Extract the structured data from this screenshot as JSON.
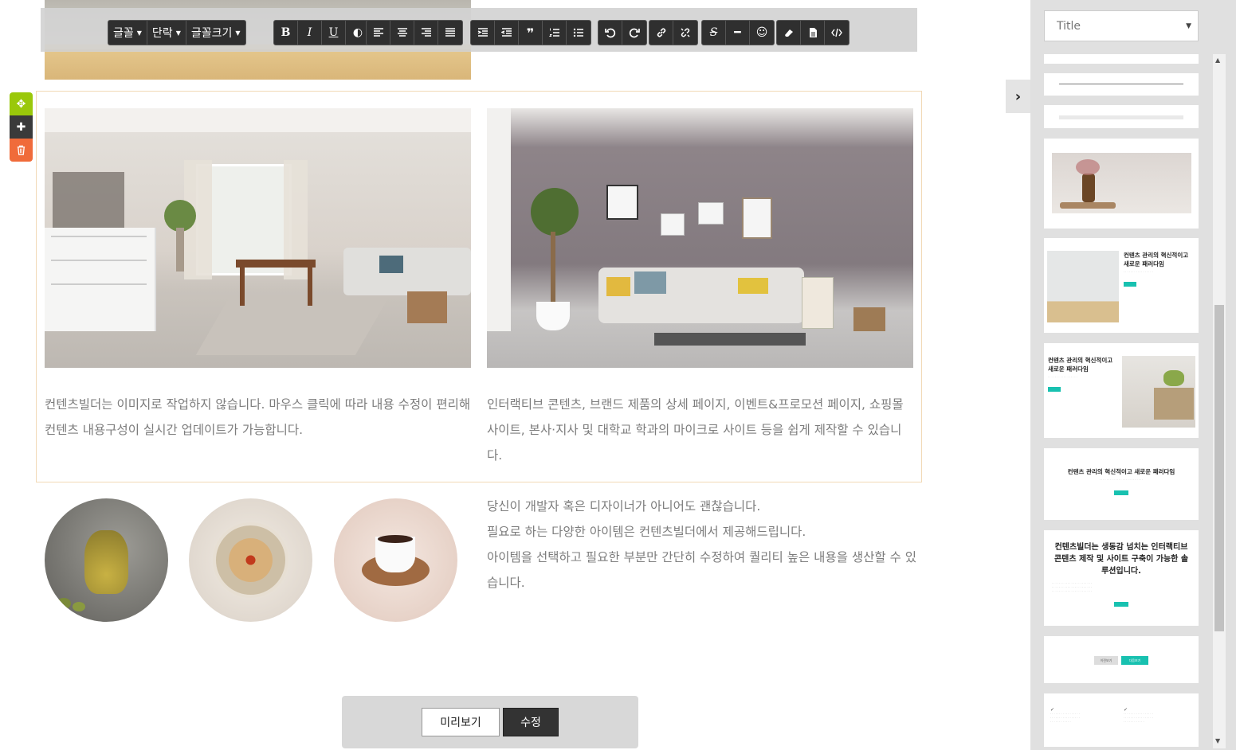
{
  "toolbar": {
    "font_label": "글꼴",
    "paragraph_label": "단락",
    "font_size_label": "글꼴크기",
    "bold": "B",
    "italic": "I",
    "underline": "U"
  },
  "content": {
    "para_left": "컨텐츠빌더는 이미지로 작업하지 않습니다. 마우스 클릭에 따라 내용 수정이 편리해 컨텐츠 내용구성이 실시간 업데이트가 가능합니다.",
    "para_right": "인터랙티브 콘텐츠, 브랜드 제품의 상세 페이지, 이벤트&프로모션 페이지, 쇼핑몰 사이트, 본사·지사 및 대학교 학과의 마이크로 사이트 등을 쉽게 제작할 수 있습니다.",
    "para3_line1": "당신이 개발자 혹은 디자이너가 아니어도 괜찮습니다.",
    "para3_line2": "필요로 하는 다양한 아이템은 컨텐츠빌더에서 제공해드립니다.",
    "para3_line3": "아이템을 선택하고 필요한 부분만 간단히 수정하여 퀄리티 높은 내용을 생산할 수 있습니다."
  },
  "actions": {
    "preview_label": "미리보기",
    "edit_label": "수정"
  },
  "panel": {
    "select_value": "Title",
    "tpl1_title": "컨텐츠 관리의 혁신적이고 새로운 패러다임",
    "tpl2_title": "컨텐츠 관리의 혁신적이고 새로운 패러다임",
    "tpl3_title": "컨텐츠 관리의 혁신적이고 새로운 패러다임",
    "tpl4_title": "컨텐츠빌더는 생동감 넘치는 인터랙티브 콘텐츠 제작 및 사이트 구축이 가능한 솔루션입니다.",
    "tpl_btn_prev": "이전보기",
    "tpl_btn_next": "다음보기"
  },
  "colors": {
    "move_handle": "#9ac80a",
    "delete_handle": "#f06b3a",
    "accent_teal": "#18c1b0",
    "toolbar_dark": "#2f2f2f"
  },
  "icons": [
    "move-icon",
    "plus-icon",
    "trash-icon",
    "chevron-right-icon",
    "link-icon",
    "unlink-icon",
    "smile-icon",
    "eraser-icon",
    "html-icon"
  ]
}
